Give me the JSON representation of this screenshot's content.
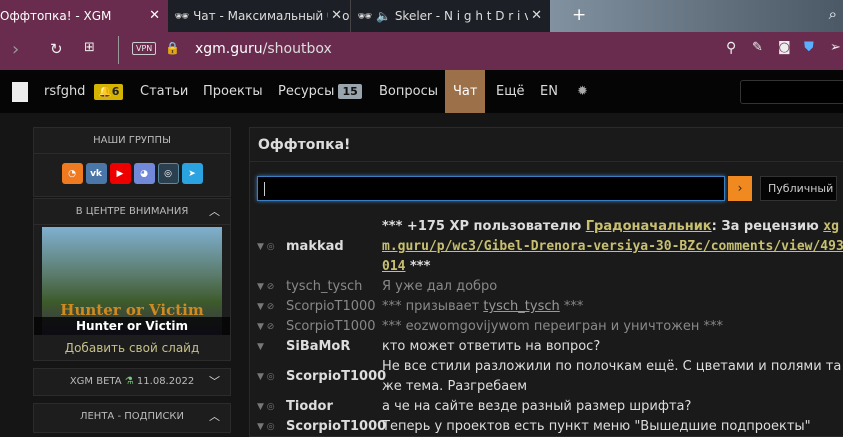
{
  "browser": {
    "tabs": [
      {
        "title": "Оффтопка! - XGM"
      },
      {
        "title": "Чат - Максимальный блог"
      },
      {
        "title": "Skeler - N i g h t D r i v e"
      }
    ],
    "url_host": "xgm.guru",
    "url_path": "/shoutbox",
    "vpn": "VPN"
  },
  "nav": {
    "user": "rsfghd",
    "notifications": "6",
    "items": [
      {
        "label": "Статьи"
      },
      {
        "label": "Проекты"
      },
      {
        "label": "Ресурсы",
        "badge": "15"
      },
      {
        "label": "Вопросы"
      },
      {
        "label": "Чат"
      },
      {
        "label": "Ещё"
      },
      {
        "label": "EN"
      }
    ]
  },
  "sidebar": {
    "groups_title": "НАШИ ГРУППЫ",
    "spotlight_title": "В ЦЕНТРЕ ВНИМАНИЯ",
    "slide_caption": "Hunter or Victim",
    "slide_logo": "Hunter or Victim",
    "add_slide": "Добавить свой слайд",
    "beta_title": "XGM BETA",
    "beta_date": "11.08.2022",
    "feed_title": "ЛЕНТА - ПОДПИСКИ"
  },
  "chat": {
    "title": "Оффтопка!",
    "input_value": "",
    "send": "›",
    "channel": "Публичный",
    "messages": [
      {
        "user": "makkad",
        "pre": "*** +175 XP пользователю ",
        "link": "Градоначальник",
        "mid": ": За рецензию ",
        "link2": "xgm.guru/p/wc3/Gibel-Drenora-versiya-30-BZc/comments/view/493014",
        "post": " ***"
      },
      {
        "user": "tysch_tysch",
        "text": "Я уже дал добро"
      },
      {
        "user": "ScorpioT1000",
        "pre": "*** призывает ",
        "link": "tysch_tysch",
        "post": " ***"
      },
      {
        "user": "ScorpioT1000",
        "text": "*** eozwomgovijywom переигран и уничтожен ***"
      },
      {
        "user": "SiBaMoR",
        "text": "кто может ответить на вопрос?"
      },
      {
        "user": "ScorpioT1000",
        "text": "Не все стили разложили по полочкам ещё. С цветами и полями та же тема. Разгребаем"
      },
      {
        "user": "Tiodor",
        "text": "а че на сайте везде разный размер шрифта?"
      },
      {
        "user": "ScorpioT1000",
        "text": "Теперь у проектов есть пункт меню \"Вышедшие подпроекты\""
      }
    ]
  }
}
